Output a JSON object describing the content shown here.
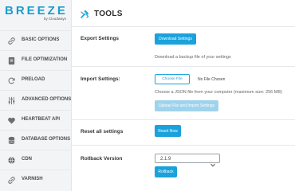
{
  "brand": {
    "name": "BREEZE",
    "sub": "by Cloudways",
    "color": "#1b9ccd"
  },
  "sidebar": {
    "items": [
      {
        "label": "BASIC OPTIONS",
        "icon": "link-icon"
      },
      {
        "label": "FILE OPTIMIZATION",
        "icon": "file-icon"
      },
      {
        "label": "PRELOAD",
        "icon": "refresh-icon"
      },
      {
        "label": "ADVANCED OPTIONS",
        "icon": "sliders-icon"
      },
      {
        "label": "HEARTBEAT API",
        "icon": "heart-icon"
      },
      {
        "label": "DATABASE OPTIONS",
        "icon": "database-icon"
      },
      {
        "label": "CDN",
        "icon": "globe-icon"
      },
      {
        "label": "VARNISH",
        "icon": "link-icon"
      }
    ]
  },
  "header": {
    "title": "TOOLS",
    "icon": "tools-icon"
  },
  "export": {
    "label": "Export Settings",
    "button": "Download Settings",
    "help": "Download a backup file of your settings"
  },
  "import": {
    "label": "Import Settings:",
    "choose_button": "Choose File",
    "file_status": "No File Chosen",
    "help": "Choose a JSON file from your computer (maximum size: 256 MB)",
    "upload_button": "Upload File and Import Settings"
  },
  "reset": {
    "label": "Reset all settings",
    "button": "Reset Now"
  },
  "rollback": {
    "label": "Rollback Version",
    "selected": "2.1.9",
    "button": "Rollback"
  },
  "colors": {
    "accent": "#1aa2dc",
    "accent_disabled": "#9fd3ec",
    "sidebar_bg": "#f3f4f6"
  }
}
